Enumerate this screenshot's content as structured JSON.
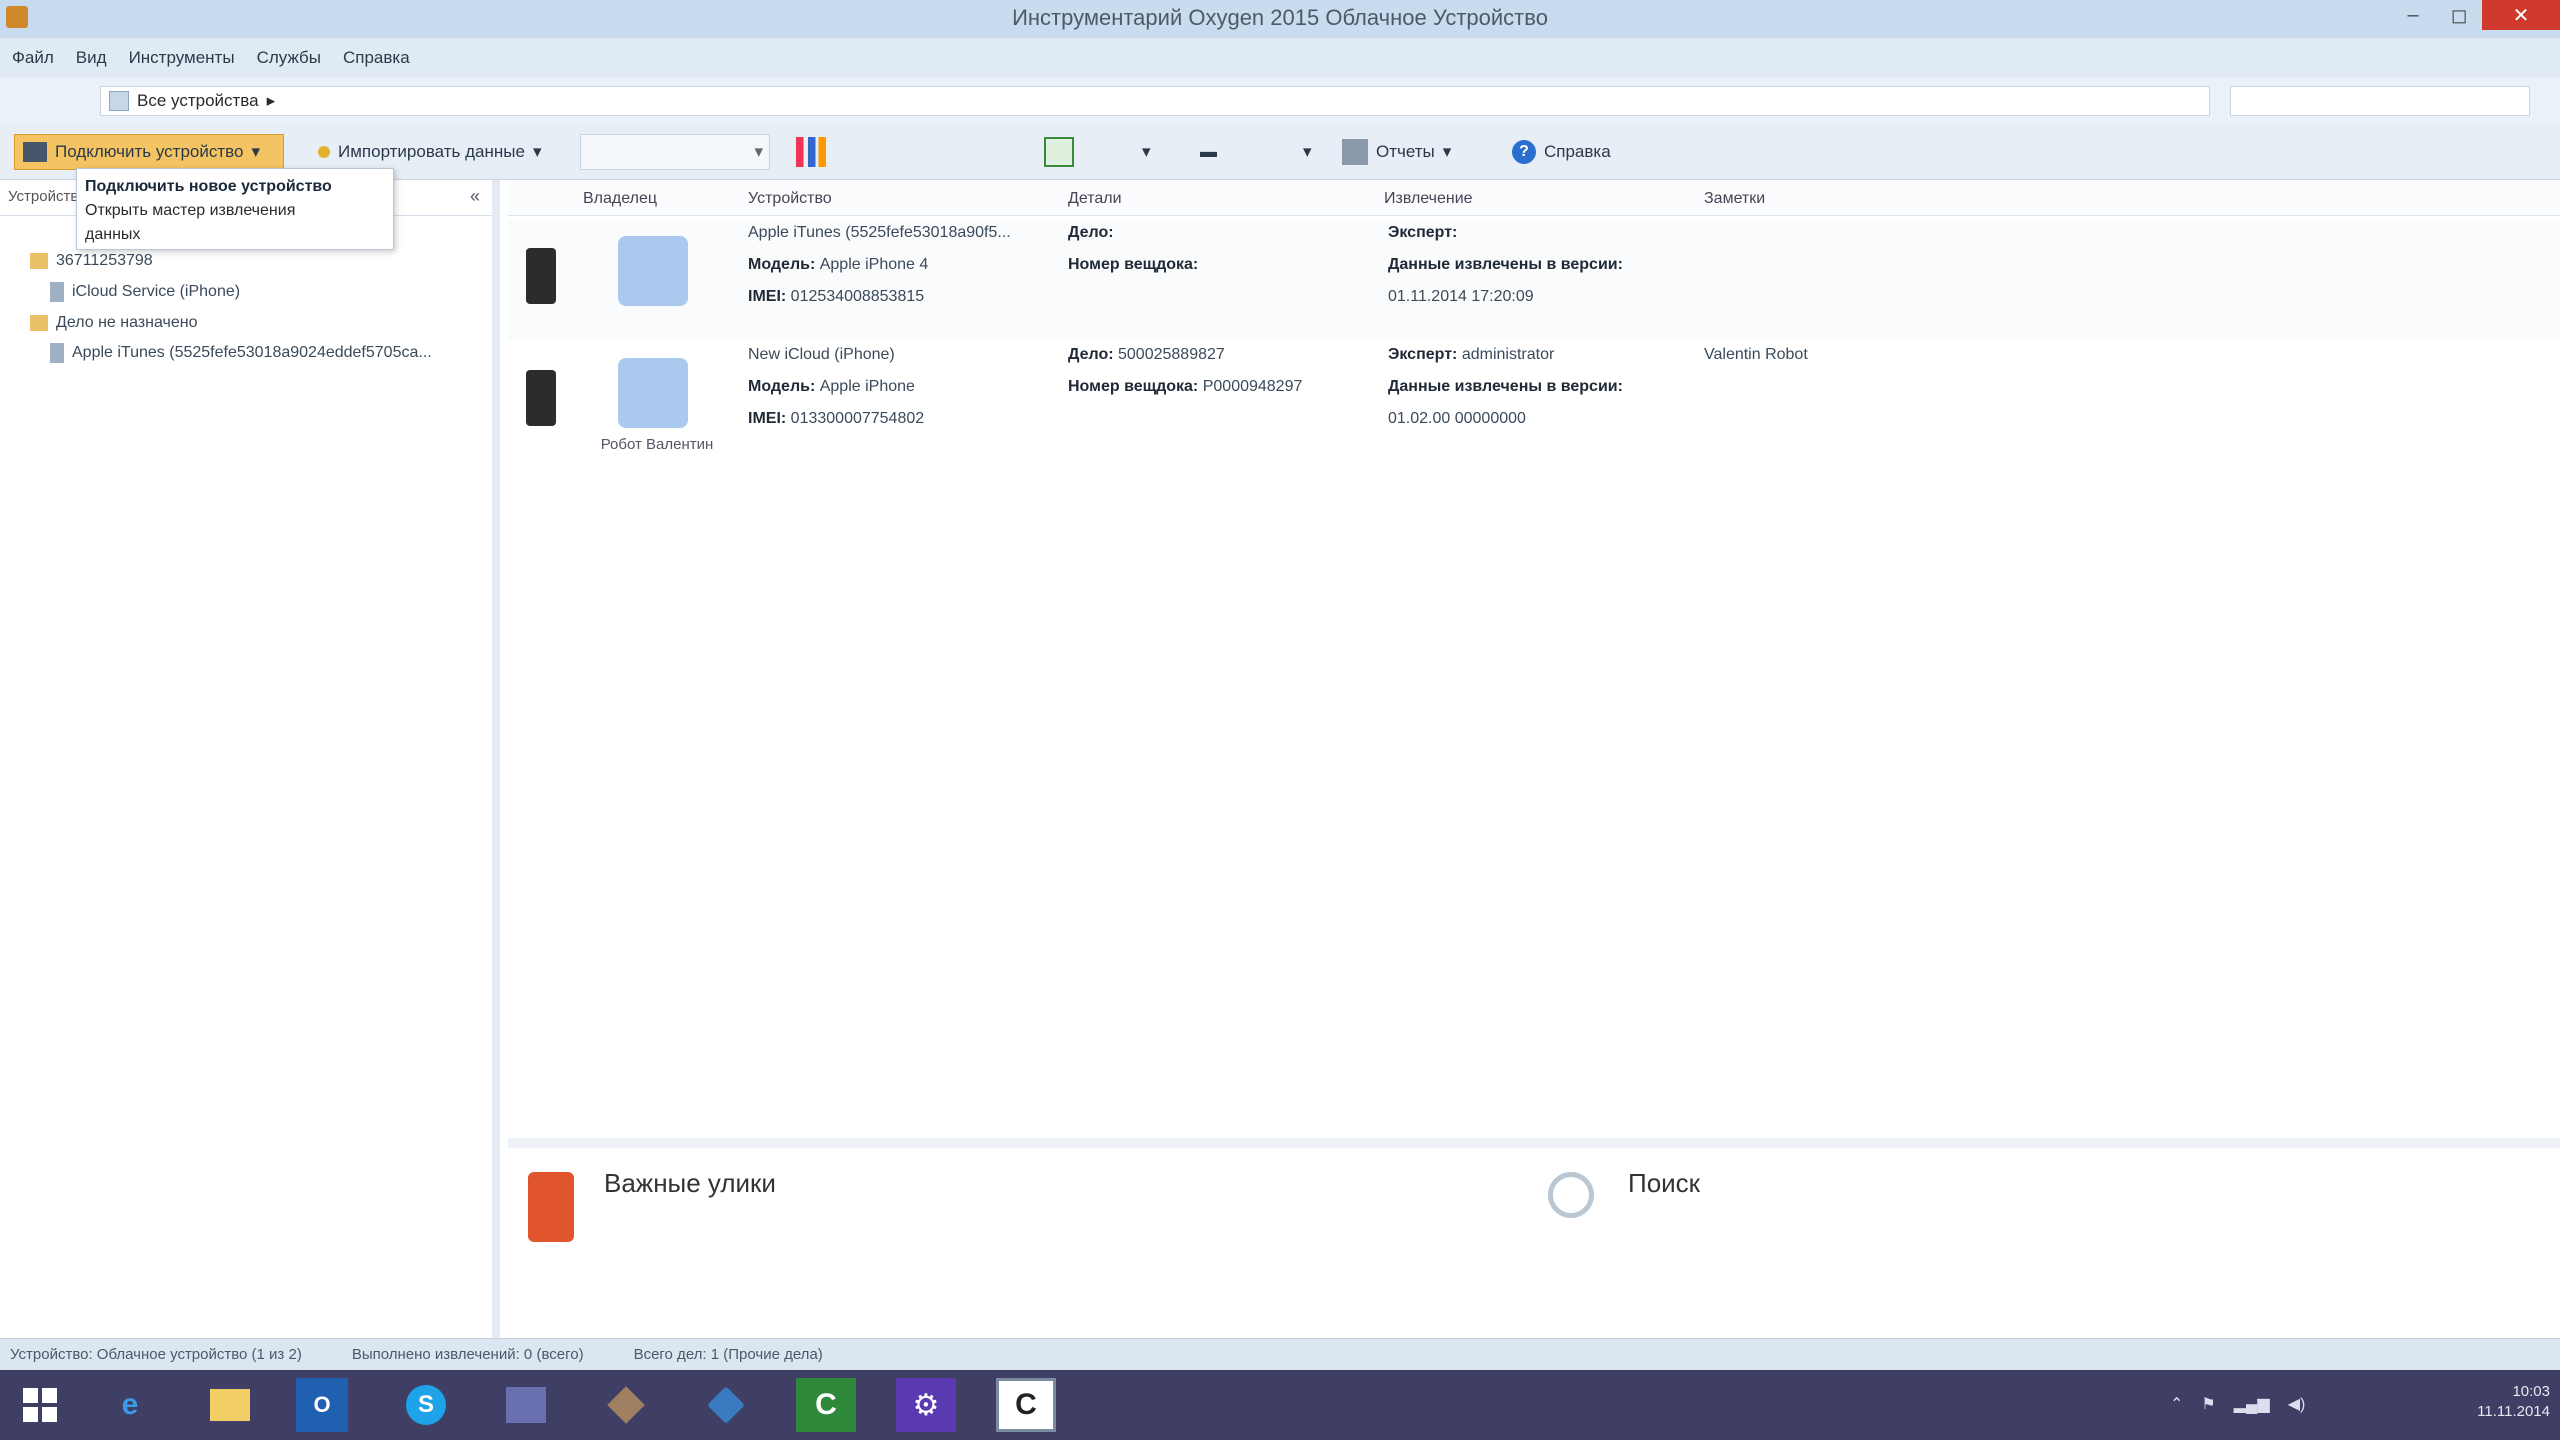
{
  "window": {
    "title": "Инструментарий Oxygen 2015 Облачное Устройство"
  },
  "menu": [
    "Файл",
    "Вид",
    "Инструменты",
    "Службы",
    "Справка"
  ],
  "address": {
    "crumb": "Все устройства"
  },
  "toolbar": {
    "connect_label": "Подключить устройство",
    "import_label": "Импортировать данные",
    "tools_label": "",
    "report_label": "Отчеты",
    "help_label": "Справка"
  },
  "dropdown": {
    "items": [
      "Подключить новое устройство",
      "Открыть мастер извлечения",
      "данных"
    ]
  },
  "left_panel": {
    "header": "Устройства",
    "tree": [
      "36711253798",
      "iCloud Service (iPhone)",
      "Дело не назначено",
      "Apple iTunes (5525fefe53018a9024eddef5705ca..."
    ]
  },
  "grid": {
    "headers": [
      "Владелец",
      "Устройство",
      "Детали",
      "Извлечение",
      "Заметки"
    ]
  },
  "devices": [
    {
      "device_name": "Apple iTunes (5525fefe53018a90f5...",
      "model_label": "Модель:",
      "model": "Apple iPhone 4",
      "imei_label": "IMEI:",
      "imei": "012534008853815",
      "case_label": "Дело:",
      "case": "",
      "evidence_label": "Номер вещдока:",
      "evidence": "",
      "expert_label": "Эксперт:",
      "expert": "",
      "extracted_label": "Данные извлечены в версии:",
      "extracted": "01.11.2014 17:20:09",
      "owner_caption": "",
      "note": ""
    },
    {
      "device_name": "New iCloud (iPhone)",
      "model_label": "Модель:",
      "model": "Apple iPhone",
      "imei_label": "IMEI:",
      "imei": "013300007754802",
      "case_label": "Дело:",
      "case": "500025889827",
      "evidence_label": "Номер вещдока:",
      "evidence": "P0000948297",
      "expert_label": "Эксперт:",
      "expert": "administrator",
      "extracted_label": "Данные извлечены в версии:",
      "extracted": "01.02.00 00000000",
      "owner_caption": "Робот Валентин",
      "note": "Valentin Robot"
    }
  ],
  "bottom": {
    "evidence_title": "Важные улики",
    "evidence_desc": "",
    "search_title": "Поиск",
    "search_desc": ""
  },
  "status": [
    "Устройство: Облачное устройство (1 из 2)",
    "Выполнено извлечений: 0 (всего)",
    "Всего дел: 1 (Прочие дела)"
  ],
  "clock": {
    "time": "10:03",
    "date": "11.11.2014"
  },
  "colors": {
    "accent": "#f4c462",
    "titlebar": "#c9dcef",
    "taskbar": "#3f3f66",
    "close": "#cf3a2c"
  }
}
